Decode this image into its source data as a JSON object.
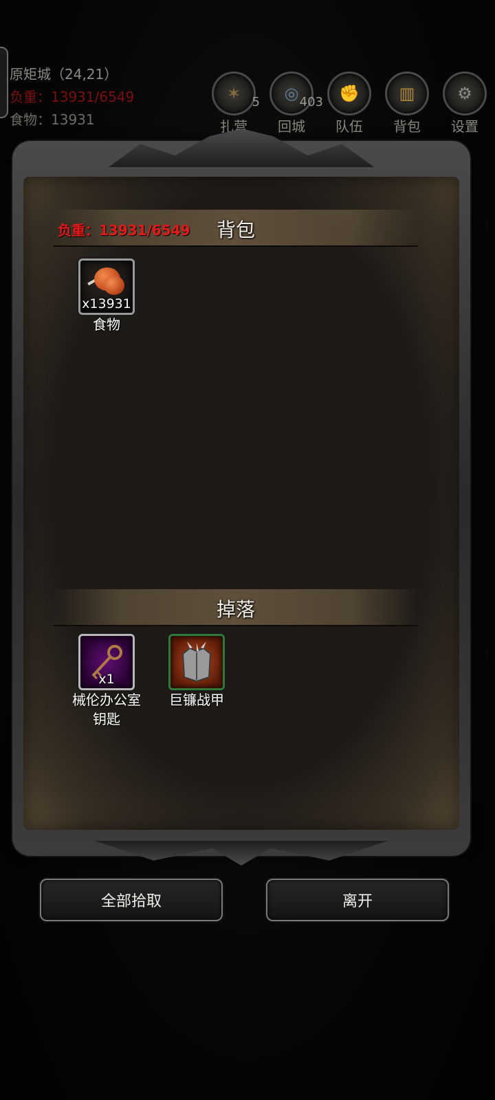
{
  "hud": {
    "location": "原矩城（24,21）",
    "load": "负重：13931/6549",
    "food": "食物：13931",
    "buttons": [
      {
        "label": "扎营",
        "badge": "5",
        "icon": "campfire-icon"
      },
      {
        "label": "回城",
        "badge": "403",
        "icon": "portal-icon"
      },
      {
        "label": "队伍",
        "badge": "",
        "icon": "team-icon"
      },
      {
        "label": "背包",
        "badge": "",
        "icon": "barrel-icon"
      },
      {
        "label": "设置",
        "badge": "",
        "icon": "gear-icon"
      }
    ]
  },
  "panel": {
    "bag": {
      "title": "背包",
      "load": "负重：13931/6549",
      "items": [
        {
          "name": "食物",
          "qty": "x13931",
          "icon": "meat-icon"
        }
      ]
    },
    "drops": {
      "title": "掉落",
      "items": [
        {
          "name": "械伦办公室\n钥匙",
          "qty": "x1",
          "icon": "key-icon"
        },
        {
          "name": "巨镰战甲",
          "qty": "",
          "icon": "armor-icon"
        }
      ]
    }
  },
  "actions": {
    "pick_all": "全部拾取",
    "leave": "离开"
  },
  "colors": {
    "load_red": "#e11a1a",
    "key_rarity": "#5e0e72",
    "armor_rarity": "#b34820"
  }
}
